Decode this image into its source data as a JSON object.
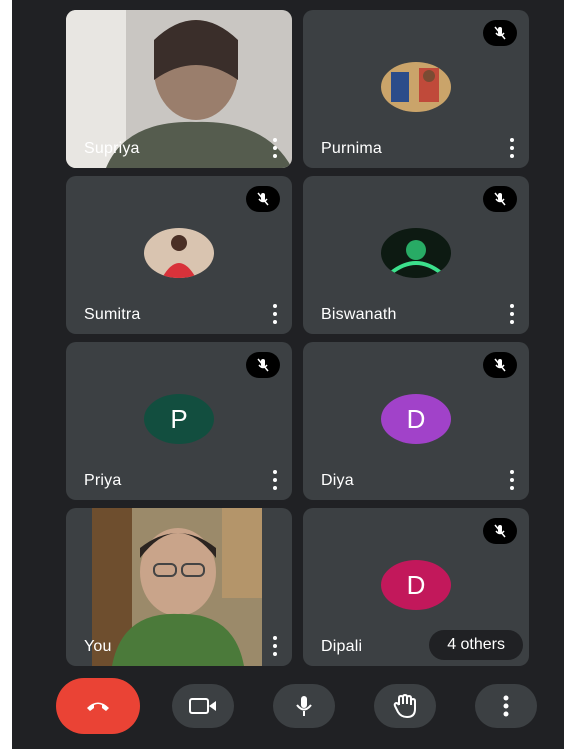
{
  "colors": {
    "background": "#202124",
    "tile": "#3c4043",
    "end_call": "#ea4335",
    "priya_avatar": "#124e3f",
    "diya_avatar": "#a142c9",
    "dipali_avatar": "#c2185b"
  },
  "participants": [
    {
      "name": "Supriya",
      "video": true
    },
    {
      "name": "Purnima",
      "muted": true,
      "avatar": "photo"
    },
    {
      "name": "Sumitra",
      "muted": true,
      "avatar": "photo"
    },
    {
      "name": "Biswanath",
      "muted": true,
      "avatar": "photo"
    },
    {
      "name": "Priya",
      "muted": true,
      "initial": "P"
    },
    {
      "name": "Diya",
      "muted": true,
      "initial": "D"
    },
    {
      "name": "You",
      "video": true
    },
    {
      "name": "Dipali",
      "muted": true,
      "initial": "D"
    }
  ],
  "others_chip": "4 others",
  "controls": [
    {
      "icon": "end-call-icon"
    },
    {
      "icon": "video-camera-icon"
    },
    {
      "icon": "microphone-icon"
    },
    {
      "icon": "raise-hand-icon"
    },
    {
      "icon": "more-options-icon"
    }
  ]
}
